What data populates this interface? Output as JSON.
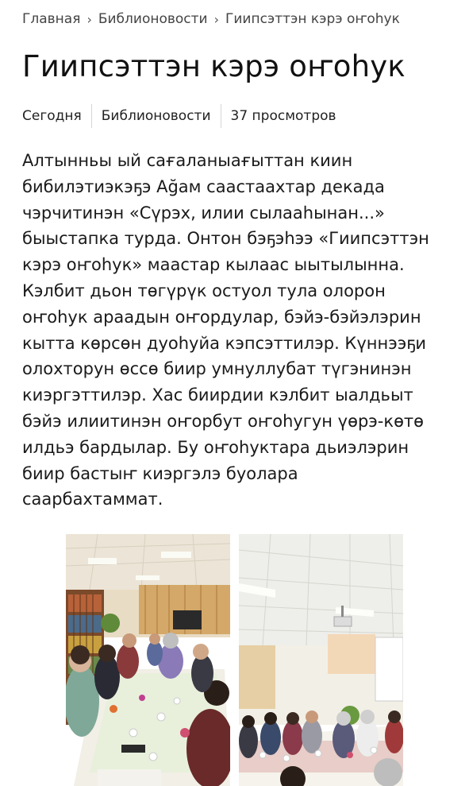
{
  "breadcrumb": {
    "items": [
      "Главная",
      "Библионовости",
      "Гиипсэттэн кэрэ оҥоһук"
    ],
    "separator": "›"
  },
  "article": {
    "title": "Гиипсэттэн кэрэ оҥоһук",
    "meta": {
      "date": "Сегодня",
      "category": "Библионовости",
      "views": "37 просмотров"
    },
    "body_lines": [
      "Алтынньы ый сағаланыағыттан киин",
      "бибилэтиэкэҕэ Ağам саастаахтар декада",
      "чэрчитинэн «Сүрэх, илии сылааһынан...»",
      "быыстапка турда. Онтон бэҕэһээ «Гиипсэттэн",
      "кэрэ оҥоһук» маастар кылаас ыытылынна.",
      "Кэлбит дьон төгүрүк остуол тула олорон",
      "оҥоһук араадын оҥордулар, бэйэ-бэйэлэрин",
      "кытта көрсөн дуоһуйа кэпсэттилэр. Күннээҕи",
      "олохторун өссө биир умнуллубат түгэнинэн",
      "киэргэттилэр. Хас биирдии кэлбит ыалдьыт",
      "бэйэ илиитинэн оҥорбут оҥоһугун үөрэ-көтө",
      "илдьэ бардылар. Бу оҥоһуктара дьиэлэрин",
      "биир бастыҥ киэргэлэ буолара",
      "саарбахтаммат."
    ]
  },
  "colors": {
    "text": "#1c1c1c",
    "muted": "#444444",
    "divider": "#d6d6d6",
    "background": "#ffffff"
  }
}
